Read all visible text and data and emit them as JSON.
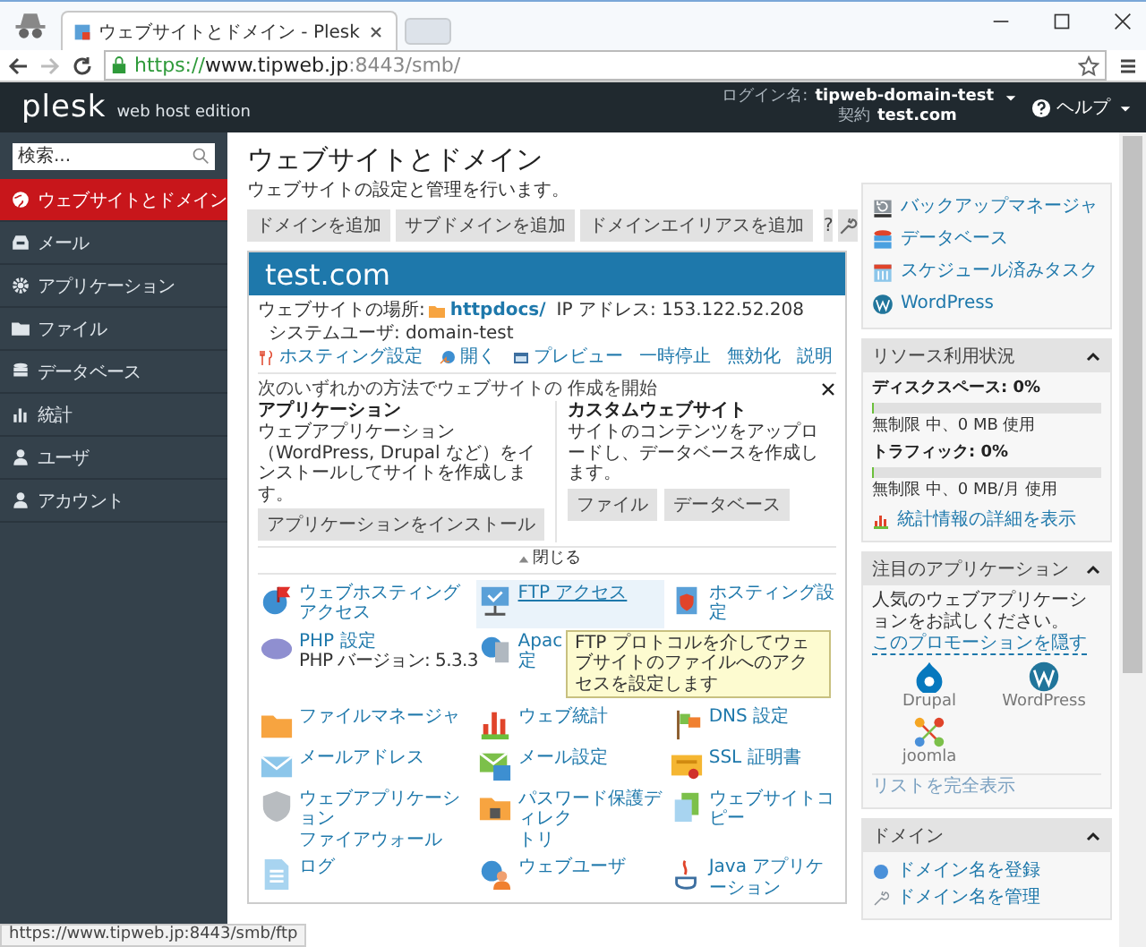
{
  "browser": {
    "tab_title": "ウェブサイトとドメイン - Plesk",
    "url_scheme": "https://",
    "url_host": "www.tipweb.jp",
    "url_rest": ":8443/smb/",
    "status_url": "https://www.tipweb.jp:8443/smb/ftp"
  },
  "header": {
    "logo": "plesk",
    "edition": "web host edition",
    "login_label": "ログイン名:",
    "login_user": "tipweb-domain-test",
    "contract_label": "契約",
    "contract_value": "test.com",
    "help": "ヘルプ"
  },
  "sidebar": {
    "search_placeholder": "検索...",
    "items": [
      {
        "label": "ウェブサイトとドメイン",
        "selected": true
      },
      {
        "label": "メール",
        "selected": false
      },
      {
        "label": "アプリケーション",
        "selected": false
      },
      {
        "label": "ファイル",
        "selected": false
      },
      {
        "label": "データベース",
        "selected": false
      },
      {
        "label": "統計",
        "selected": false
      },
      {
        "label": "ユーザ",
        "selected": false
      },
      {
        "label": "アカウント",
        "selected": false
      }
    ]
  },
  "page": {
    "title": "ウェブサイトとドメイン",
    "subtitle": "ウェブサイトの設定と管理を行います。",
    "buttons": [
      "ドメインを追加",
      "サブドメインを追加",
      "ドメインエイリアスを追加"
    ],
    "help_button": "?"
  },
  "domain": {
    "name": "test.com",
    "location_label": "ウェブサイトの場所:",
    "docroot": "httpdocs/",
    "ip": "IP アドレス: 153.122.52.208",
    "system_user": "システムユーザ: domain-test",
    "actions": [
      "ホスティング設定",
      "開く",
      "プレビュー",
      "一時停止",
      "無効化",
      "説明"
    ]
  },
  "start": {
    "title": "次のいずれかの方法でウェブサイトの 作成を開始",
    "columns": [
      {
        "heading": "アプリケーション",
        "text": "ウェブアプリケーション（WordPress, Drupal など）をインストールしてサイトを作成します。",
        "buttons": [
          "アプリケーションをインストール"
        ]
      },
      {
        "heading": "カスタムウェブサイト",
        "text": "サイトのコンテンツをアップロードし、データベースを作成します。",
        "buttons": [
          "ファイル",
          "データベース"
        ]
      }
    ],
    "collapse": "閉じる"
  },
  "tools": [
    {
      "kind": "tool",
      "label": [
        "ウェブホスティングアクセス"
      ],
      "hovered": false
    },
    {
      "kind": "tool",
      "label": [
        "FTP アクセス"
      ],
      "hovered": true
    },
    {
      "kind": "tool",
      "label": [
        "ホスティング設定"
      ],
      "hovered": false
    },
    {
      "kind": "tool",
      "label": [
        "PHP 設定"
      ],
      "note": "PHP バージョン: 5.3.3",
      "hovered": false
    },
    {
      "kind": "tool",
      "label": [
        "Apac",
        "定"
      ],
      "hovered": false
    },
    {
      "kind": "covered"
    },
    {
      "kind": "tool",
      "label": [
        "ファイルマネージャ"
      ],
      "hovered": false
    },
    {
      "kind": "tool",
      "label": [
        "ウェブ統計"
      ],
      "hovered": false
    },
    {
      "kind": "tool",
      "label": [
        "DNS 設定"
      ],
      "hovered": false
    },
    {
      "kind": "tool",
      "label": [
        "メールアドレス"
      ],
      "hovered": false
    },
    {
      "kind": "tool",
      "label": [
        "メール設定"
      ],
      "hovered": false
    },
    {
      "kind": "tool",
      "label": [
        "SSL 証明書"
      ],
      "hovered": false
    },
    {
      "kind": "tool",
      "label": [
        "ウェブアプリケーション",
        "ファイアウォール"
      ],
      "hovered": false
    },
    {
      "kind": "tool",
      "label": [
        "パスワード保護ディレク",
        "トリ"
      ],
      "hovered": false
    },
    {
      "kind": "tool",
      "label": [
        "ウェブサイトコピー"
      ],
      "hovered": false
    },
    {
      "kind": "tool",
      "label": [
        "ログ"
      ],
      "hovered": false
    },
    {
      "kind": "tool",
      "label": [
        "ウェブユーザ"
      ],
      "hovered": false
    },
    {
      "kind": "tool",
      "label": [
        "Java アプリケーション"
      ],
      "hovered": false
    }
  ],
  "tooltip": "FTP プロトコルを介してウェブサイトのファイルへのアクセスを設定します",
  "right": {
    "quick_links": [
      "バックアップマネージャ",
      "データベース",
      "スケジュール済みタスク",
      "WordPress"
    ],
    "resources": {
      "title": "リソース利用状況",
      "rows": [
        {
          "label": "ディスクスペース: 0%",
          "level": 0,
          "note": "無制限 中、0 MB 使用"
        },
        {
          "label": "トラフィック: 0%",
          "level": 0,
          "note": "無制限 中、0 MB/月 使用"
        }
      ],
      "stats_link": "統計情報の詳細を表示"
    },
    "featured": {
      "title": "注目のアプリケーション",
      "text": "人気のウェブアプリケーションをお試しください。",
      "hide_link": "このプロモーションを隠す",
      "apps": [
        "Drupal",
        "WordPress",
        "joomla"
      ],
      "show_all": "リストを完全表示"
    },
    "domains": {
      "title": "ドメイン",
      "links": [
        "ドメイン名を登録",
        "ドメイン名を管理"
      ]
    }
  }
}
